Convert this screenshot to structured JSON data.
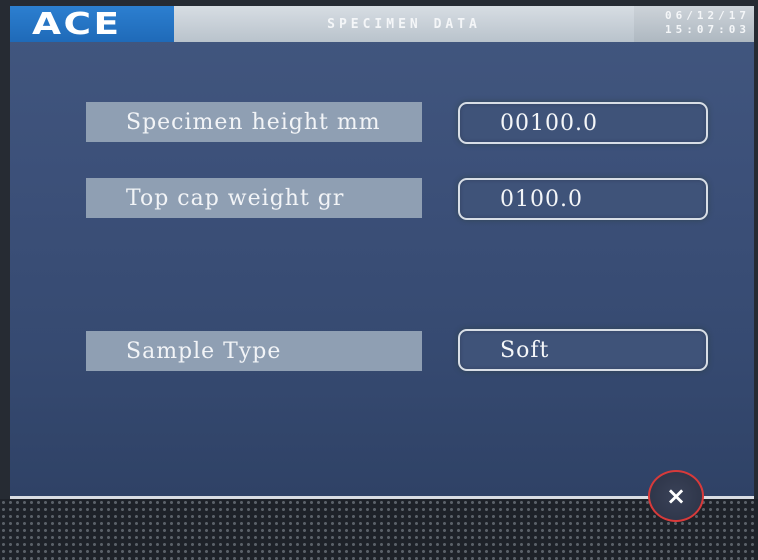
{
  "header": {
    "logo": "ACE",
    "title": "SPECIMEN DATA",
    "date": "06/12/17",
    "time": "15:07:03"
  },
  "fields": [
    {
      "label": "Specimen height  mm",
      "value": "00100.0"
    },
    {
      "label": "Top cap weight gr",
      "value": "0100.0"
    },
    {
      "label": "Sample Type",
      "value": "Soft"
    }
  ],
  "close_button": {
    "symbol": "×"
  },
  "colors": {
    "screen_bg": "#3c5079",
    "logo_bg": "#1f6ab8",
    "label_bg": "#8f9fb3",
    "value_border": "#d8dee6",
    "close_ring": "#d83a3a"
  },
  "icons": {
    "close": "close-icon"
  }
}
